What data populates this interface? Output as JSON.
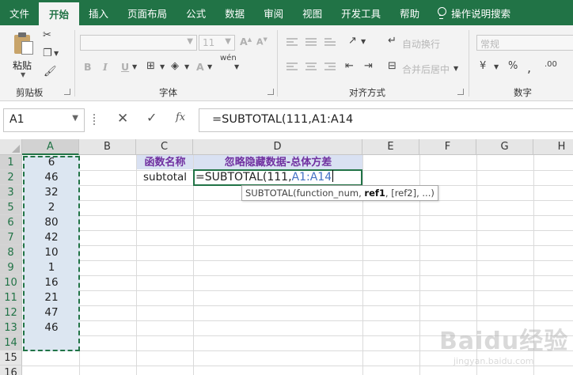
{
  "menu": {
    "tabs": [
      "文件",
      "开始",
      "插入",
      "页面布局",
      "公式",
      "数据",
      "审阅",
      "视图",
      "开发工具",
      "帮助"
    ],
    "active_index": 1,
    "tell_me": "操作说明搜索"
  },
  "ribbon": {
    "paste_label": "粘贴",
    "clipboard_label": "剪贴板",
    "font_label": "字体",
    "font_size": "11",
    "bold": "B",
    "italic": "I",
    "underline": "U",
    "align_label": "对齐方式",
    "wrap_text": "自动换行",
    "merge_center": "合并后居中",
    "number_label": "数字",
    "number_format": "常规"
  },
  "formula_bar": {
    "name_box": "A1",
    "cancel": "✕",
    "enter": "✓",
    "fx": "fx",
    "formula": "=SUBTOTAL(111,A1:A14"
  },
  "grid": {
    "columns": [
      "A",
      "B",
      "C",
      "D",
      "E",
      "F",
      "G",
      "H"
    ],
    "rows": [
      "1",
      "2",
      "3",
      "5",
      "6",
      "7",
      "8",
      "9",
      "10",
      "11",
      "12",
      "13",
      "14",
      "15",
      "16"
    ],
    "col_a_values": [
      "6",
      "46",
      "32",
      "2",
      "80",
      "42",
      "10",
      "1",
      "16",
      "21",
      "47",
      "46"
    ],
    "c1": "函数名称",
    "d1": "忽略隐藏数据-总体方差",
    "c2": "subtotal",
    "edit": {
      "prefix": "=SUBTOTAL(111,",
      "ref": "A1:A14"
    },
    "tooltip": {
      "fn": "SUBTOTAL(function_num, ",
      "arg_bold": "ref1",
      "rest": ", [ref2], ...)"
    }
  },
  "watermark": {
    "text": "Baidu经验",
    "sub": "jingyan.baidu.com"
  }
}
